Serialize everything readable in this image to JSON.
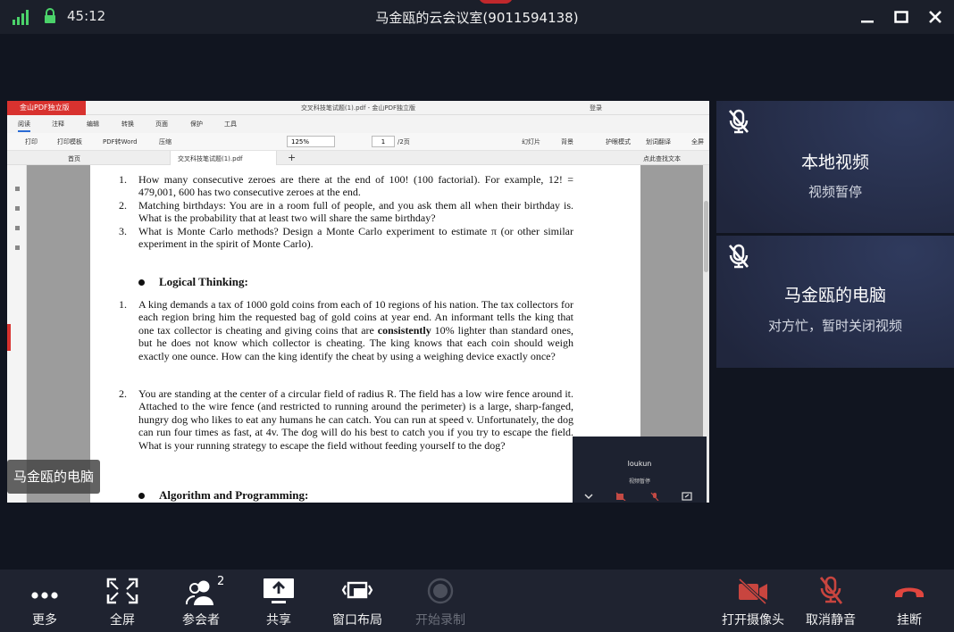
{
  "titlebar": {
    "time": "45:12",
    "meeting_title": "马金瓯的云会议室(9011594138)"
  },
  "pdf_app": {
    "badge": "金山PDF独立版",
    "window_title": "交叉科技笔试题(1).pdf - 金山PDF独立版",
    "login": "登录",
    "menu": [
      "阅读",
      "注释",
      "编辑",
      "转换",
      "页面",
      "保护",
      "工具"
    ],
    "toolbar": {
      "print": "打印",
      "print_template": "打印模板",
      "pdf_to_word": "PDF转Word",
      "compress": "压缩",
      "zoom": "125%",
      "page_current": "1",
      "page_total": "/2页",
      "slideshow": "幻灯片",
      "background": "背景",
      "eye_care": "护眼模式",
      "translate": "划词翻译",
      "fullscreen": "全屏"
    },
    "tabs": {
      "home": "首页",
      "document": "交叉科技笔试题(1).pdf",
      "search": "点此查找文本"
    }
  },
  "document": {
    "q1_num": "1.",
    "q1": "How many consecutive zeroes are there at the end of 100! (100 factorial). For example, 12! = 479,001, 600 has two consecutive zeroes at the end.",
    "q2_num": "2.",
    "q2": "Matching birthdays: You are in a room full of people, and you ask them all when their birthday is. What is the probability that at least two will share the same birthday?",
    "q3_num": "3.",
    "q3": "What is Monte Carlo methods? Design a Monte Carlo experiment to estimate π (or other similar experiment in the spirit of Monte Carlo).",
    "section1": "Logical Thinking:",
    "l1_num": "1.",
    "l1_a": "A king demands a tax of 1000 gold coins from each of 10 regions of his nation. The tax collectors for each region bring him the requested bag of gold coins at year end. An informant tells the king that one tax collector is cheating and giving coins that are ",
    "l1_bold": "consistently",
    "l1_b": " 10% lighter than standard ones, but he does not know which collector is cheating. The king knows that each coin should weigh exactly one ounce. How can the king identify the cheat by using a weighing device exactly once?",
    "l2_num": "2.",
    "l2": "You are standing at the center of a circular field of radius R. The field has a low wire fence around it. Attached to the wire fence (and restricted to running around the perimeter) is a large, sharp-fanged, hungry dog who likes to eat any humans he can catch. You can run at speed v. Unfortunately, the dog can run four times as fast, at 4v. The dog will do his best to catch you if you try to escape the field. What is your running strategy to escape the field without feeding yourself to the dog?",
    "section2": "Algorithm and Programming:"
  },
  "pip": {
    "name": "loukun",
    "status": "视频暂停"
  },
  "speaker_overlay": "马金瓯的电脑",
  "right_panels": [
    {
      "name": "本地视频",
      "status": "视频暂停"
    },
    {
      "name": "马金瓯的电脑",
      "status": "对方忙，暂时关闭视频"
    }
  ],
  "controls": {
    "more": "更多",
    "fullscreen": "全屏",
    "participants": "参会者",
    "participant_count": "2",
    "share": "共享",
    "layout": "窗口布局",
    "record": "开始录制",
    "camera": "打开摄像头",
    "unmute": "取消静音",
    "hangup": "挂断"
  },
  "colors": {
    "accent_red": "#d8322f",
    "signal_green": "#4bd26a",
    "panel_bg": "#20263d"
  }
}
